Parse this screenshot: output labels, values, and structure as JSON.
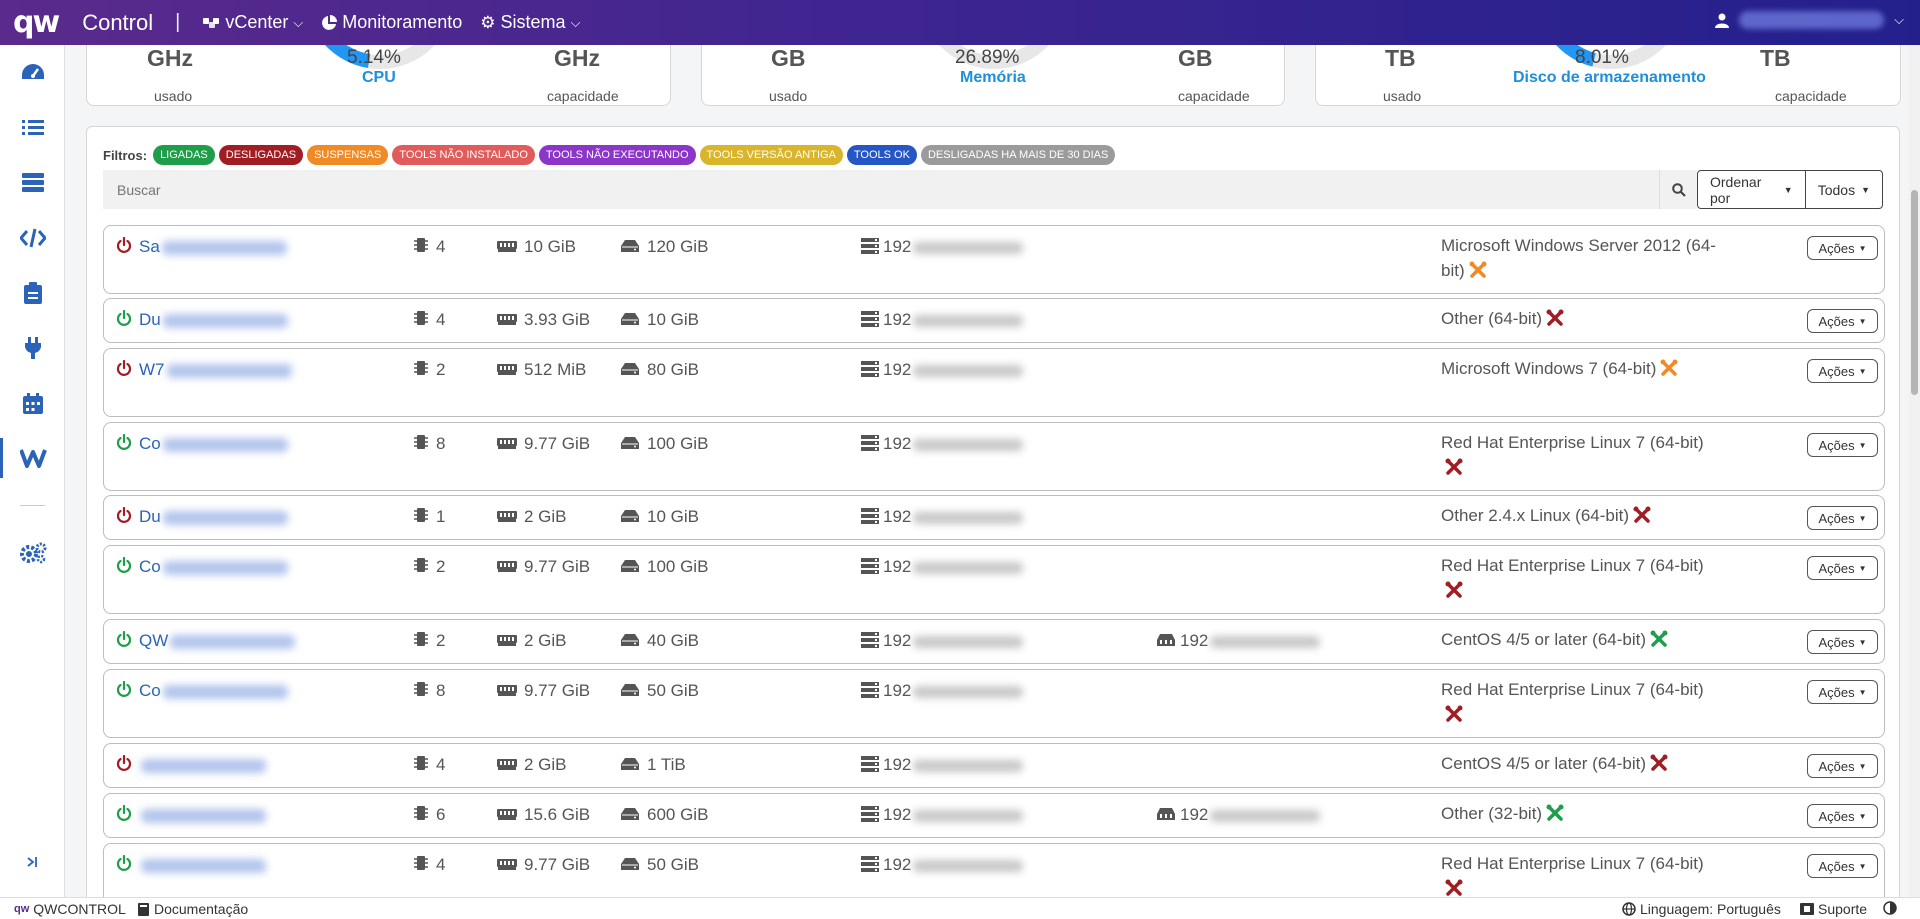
{
  "topbar": {
    "logo": "qw",
    "title": "Control",
    "separator": "|",
    "menus": [
      {
        "label": "vCenter"
      },
      {
        "label": "Monitoramento"
      },
      {
        "label": "Sistema"
      }
    ]
  },
  "cards": [
    {
      "used_unit": "GHz",
      "used_label": "usado",
      "percent": "5.14%",
      "name": "CPU",
      "cap_unit": "GHz",
      "cap_label": "capacidade",
      "fraction": 0.0514
    },
    {
      "used_unit": "GB",
      "used_label": "usado",
      "percent": "26.89%",
      "name": "Memória",
      "cap_unit": "GB",
      "cap_label": "capacidade",
      "fraction": 0.2689
    },
    {
      "used_unit": "TB",
      "used_label": "usado",
      "percent": "8.01%",
      "name": "Disco de armazenamento",
      "cap_unit": "TB",
      "cap_label": "capacidade",
      "fraction": 0.0801
    }
  ],
  "filters": {
    "label": "Filtros:",
    "chips": [
      {
        "label": "LIGADAS",
        "color": "#1e9e4a"
      },
      {
        "label": "DESLIGADAS",
        "color": "#a11d24"
      },
      {
        "label": "SUSPENSAS",
        "color": "#f08a24"
      },
      {
        "label": "TOOLS NÃO INSTALADO",
        "color": "#e25b5b"
      },
      {
        "label": "TOOLS NÃO EXECUTANDO",
        "color": "#8b35c9"
      },
      {
        "label": "TOOLS VERSÃO ANTIGA",
        "color": "#d9b52b"
      },
      {
        "label": "TOOLS OK",
        "color": "#2457c5"
      },
      {
        "label": "DESLIGADAS HA MAIS DE 30 DIAS",
        "color": "#9b9b9b"
      }
    ]
  },
  "search": {
    "placeholder": "Buscar",
    "value": ""
  },
  "order_label": "Ordenar por",
  "all_label": "Todos",
  "actions_label": "Ações",
  "vms": [
    {
      "name": "Sa",
      "state": "off",
      "cpu": "4",
      "mem": "10 GiB",
      "disk": "120 GiB",
      "ip": "192",
      "ip2": "",
      "os": "Microsoft Windows Server 2012 (64-bit)",
      "tools": "old"
    },
    {
      "name": "Du",
      "state": "on",
      "cpu": "4",
      "mem": "3.93 GiB",
      "disk": "10 GiB",
      "ip": "192",
      "ip2": "",
      "os": "Other (64-bit)",
      "tools": "not-running"
    },
    {
      "name": "W7",
      "state": "off",
      "cpu": "2",
      "mem": "512 MiB",
      "disk": "80 GiB",
      "ip": "192",
      "ip2": "",
      "os": "Microsoft Windows 7 (64-bit)",
      "tools": "old"
    },
    {
      "name": "Co",
      "state": "on",
      "cpu": "8",
      "mem": "9.77 GiB",
      "disk": "100 GiB",
      "ip": "192",
      "ip2": "",
      "os": "Red Hat Enterprise Linux 7 (64-bit)",
      "tools": "not-running"
    },
    {
      "name": "Du",
      "state": "off",
      "cpu": "1",
      "mem": "2 GiB",
      "disk": "10 GiB",
      "ip": "192",
      "ip2": "",
      "os": "Other 2.4.x Linux (64-bit)",
      "tools": "not-running"
    },
    {
      "name": "Co",
      "state": "on",
      "cpu": "2",
      "mem": "9.77 GiB",
      "disk": "100 GiB",
      "ip": "192",
      "ip2": "",
      "os": "Red Hat Enterprise Linux 7 (64-bit)",
      "tools": "not-running"
    },
    {
      "name": "QW",
      "state": "on",
      "cpu": "2",
      "mem": "2 GiB",
      "disk": "40 GiB",
      "ip": "192",
      "ip2": "192",
      "os": "CentOS 4/5 or later (64-bit)",
      "tools": "ok"
    },
    {
      "name": "Co",
      "state": "on",
      "cpu": "8",
      "mem": "9.77 GiB",
      "disk": "50 GiB",
      "ip": "192",
      "ip2": "",
      "os": "Red Hat Enterprise Linux 7 (64-bit)",
      "tools": "not-running"
    },
    {
      "name": "",
      "state": "off",
      "cpu": "4",
      "mem": "2 GiB",
      "disk": "1 TiB",
      "ip": "192",
      "ip2": "",
      "os": "CentOS 4/5 or later (64-bit)",
      "tools": "not-running"
    },
    {
      "name": "",
      "state": "on",
      "cpu": "6",
      "mem": "15.6 GiB",
      "disk": "600 GiB",
      "ip": "192",
      "ip2": "192",
      "os": "Other (32-bit)",
      "tools": "ok"
    },
    {
      "name": "",
      "state": "on",
      "cpu": "4",
      "mem": "9.77 GiB",
      "disk": "50 GiB",
      "ip": "192",
      "ip2": "",
      "os": "Red Hat Enterprise Linux 7 (64-bit)",
      "tools": "not-running"
    }
  ],
  "colors": {
    "on": "#1e9e4a",
    "off": "#a11d24",
    "tools_old": "#f08a24",
    "tools_bad": "#a11d24",
    "tools_ok": "#1e9e4a",
    "accent": "#2a63b8"
  },
  "sidebar": {
    "icons": [
      "dashboard-icon",
      "list-icon",
      "server-icon",
      "code-icon",
      "clipboard-icon",
      "plug-icon",
      "calendar-icon",
      "vmware-icon",
      "settings-icon",
      "collapse-icon"
    ]
  },
  "footer": {
    "brand": "QWCONTROL",
    "docs": "Documentação",
    "language": "Linguagem: Português",
    "support": "Suporte"
  }
}
